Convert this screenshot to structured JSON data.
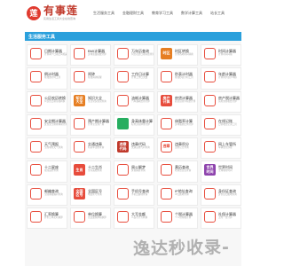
{
  "logo": {
    "name": "有事莲",
    "mark": "莲",
    "slogan": "实用生活工具大全在线查询"
  },
  "nav": [
    "生活服务工具",
    "金融理财工具",
    "教育学习工具",
    "数学计算工具",
    "站长工具"
  ],
  "panel_title": "生活服务工具",
  "tiles": [
    {
      "name": "日期计算器",
      "desc": "计算两个日期之间相差天数",
      "icon": "calendar-icon",
      "glyph": "",
      "color": "#ffffff",
      "fg": "#e74c3c"
    },
    {
      "name": "BMI计算器",
      "desc": "身体质量指数计算",
      "icon": "scale-icon",
      "glyph": "",
      "color": "#ffffff",
      "fg": "#e74c3c"
    },
    {
      "name": "万年历查询",
      "desc": "公历农历日期对照查询",
      "icon": "calendar-icon",
      "glyph": "",
      "color": "#ffffff",
      "fg": "#e74c3c"
    },
    {
      "name": "时区转换",
      "desc": "世界各地时间转换",
      "icon": "timezone-icon",
      "glyph": "时区",
      "color": "#e67e22",
      "fg": "#ffffff"
    },
    {
      "name": "时间计算器",
      "desc": "计算时间间隔",
      "icon": "clock-icon",
      "glyph": "",
      "color": "#ffffff",
      "fg": "#e74c3c"
    },
    {
      "name": "倒计时器",
      "desc": "在线倒计时工具",
      "icon": "stopwatch-icon",
      "glyph": "",
      "color": "#ffffff",
      "fg": "#e74c3c"
    },
    {
      "name": "闹钟",
      "desc": "在线闹钟提醒",
      "icon": "alarm-icon",
      "glyph": "",
      "color": "#ffffff",
      "fg": "#e74c3c"
    },
    {
      "name": "工作日计算",
      "desc": "计算工作日天数",
      "icon": "calendar-icon",
      "glyph": "",
      "color": "#ffffff",
      "fg": "#e74c3c"
    },
    {
      "name": "秒表计时器",
      "desc": "在线秒表计时工具",
      "icon": "timer-icon",
      "glyph": "",
      "color": "#ffffff",
      "fg": "#e74c3c"
    },
    {
      "name": "年龄计算器",
      "desc": "计算周岁虚岁年龄",
      "icon": "person-icon",
      "glyph": "",
      "color": "#ffffff",
      "fg": "#e74c3c"
    },
    {
      "name": "公历农历转换",
      "desc": "公农历日期互相转换",
      "icon": "calendar-icon",
      "glyph": "",
      "color": "#ffffff",
      "fg": "#e74c3c"
    },
    {
      "name": "知识大全",
      "desc": "生活常识知识查询",
      "icon": "knowledge-icon",
      "glyph": "知识\n大全",
      "color": "#e67e22",
      "fg": "#ffffff"
    },
    {
      "name": "油耗计算器",
      "desc": "汽车油耗费用计算",
      "icon": "fuel-icon",
      "glyph": "",
      "color": "#ffffff",
      "fg": "#e74c3c"
    },
    {
      "name": "房贷计算器",
      "desc": "商业贷款公积金计算",
      "icon": "house-loan-icon",
      "glyph": "房产\n计算",
      "color": "#e74c3c",
      "fg": "#ffffff"
    },
    {
      "name": "房产税计算器",
      "desc": "房屋交易税费计算",
      "icon": "house-icon",
      "glyph": "",
      "color": "#ffffff",
      "fg": "#e74c3c"
    },
    {
      "name": "安全期计算器",
      "desc": "女性安全期排卵期计算",
      "icon": "heart-icon",
      "glyph": "",
      "color": "#ffffff",
      "fg": "#e74c3c"
    },
    {
      "name": "预产期计算器",
      "desc": "计算宝宝预产期",
      "icon": "baby-icon",
      "glyph": "",
      "color": "#ffffff",
      "fg": "#e74c3c"
    },
    {
      "name": "身高体重计算",
      "desc": "标准身高体重计算",
      "icon": "height-icon",
      "glyph": "",
      "color": "#27ae60",
      "fg": "#ffffff"
    },
    {
      "name": "体脂率计算",
      "desc": "身体脂肪比例计算",
      "icon": "body-icon",
      "glyph": "",
      "color": "#ffffff",
      "fg": "#e74c3c"
    },
    {
      "name": "在线记账",
      "desc": "日常收支记录工具",
      "icon": "wallet-icon",
      "glyph": "",
      "color": "#ffffff",
      "fg": "#e74c3c"
    },
    {
      "name": "天气预报",
      "desc": "全国城市天气查询",
      "icon": "weather-icon",
      "glyph": "",
      "color": "#ffffff",
      "fg": "#e74c3c"
    },
    {
      "name": "交通违章",
      "desc": "机动车违章查询",
      "icon": "traffic-icon",
      "glyph": "",
      "color": "#ffffff",
      "fg": "#e74c3c"
    },
    {
      "name": "违章代码",
      "desc": "交通违章代码查询",
      "icon": "code-icon",
      "glyph": "违章\n代码",
      "color": "#c0392b",
      "fg": "#ffffff"
    },
    {
      "name": "违章积分",
      "desc": "违章记分查询",
      "icon": "points-icon",
      "glyph": "违章",
      "color": "#ffffff",
      "fg": "#e74c3c"
    },
    {
      "name": "网上车管所",
      "desc": "车辆业务办理",
      "icon": "car-icon",
      "glyph": "",
      "color": "#ffffff",
      "fg": "#e74c3c"
    },
    {
      "name": "十二星座",
      "desc": "星座运势查询",
      "icon": "star-icon",
      "glyph": "",
      "color": "#ffffff",
      "fg": "#e74c3c"
    },
    {
      "name": "十二生肖",
      "desc": "生肖属相查询",
      "icon": "zodiac-icon",
      "glyph": "生肖",
      "color": "#e74c3c",
      "fg": "#ffffff"
    },
    {
      "name": "周公解梦",
      "desc": "梦境解析查询",
      "icon": "dream-icon",
      "glyph": "",
      "color": "#ffffff",
      "fg": "#e74c3c"
    },
    {
      "name": "黄历查询",
      "desc": "老黄历宜忌查询",
      "icon": "almanac-icon",
      "glyph": "",
      "color": "#ffffff",
      "fg": "#e74c3c"
    },
    {
      "name": "世界时间",
      "desc": "全球城市时间",
      "icon": "world-time-icon",
      "glyph": "世界\n时间",
      "color": "#8e44ad",
      "fg": "#ffffff"
    },
    {
      "name": "邮编查询",
      "desc": "全国邮政编码查询",
      "icon": "post-icon",
      "glyph": "",
      "color": "#ffffff",
      "fg": "#e74c3c"
    },
    {
      "name": "全国区号",
      "desc": "电话区号查询",
      "icon": "area-code-icon",
      "glyph": "全国\n区号",
      "color": "#e74c3c",
      "fg": "#ffffff"
    },
    {
      "name": "手机号查询",
      "desc": "手机归属地查询",
      "icon": "phone-icon",
      "glyph": "",
      "color": "#ffffff",
      "fg": "#e74c3c"
    },
    {
      "name": "IP地址查询",
      "desc": "IP归属地查询",
      "icon": "ip-icon",
      "glyph": "",
      "color": "#ffffff",
      "fg": "#e74c3c"
    },
    {
      "name": "身份证查询",
      "desc": "身份证归属地查询",
      "icon": "id-card-icon",
      "glyph": "",
      "color": "#ffffff",
      "fg": "#e74c3c"
    },
    {
      "name": "汇率换算",
      "desc": "外币汇率实时换算",
      "icon": "exchange-icon",
      "glyph": "",
      "color": "#ffffff",
      "fg": "#e74c3c"
    },
    {
      "name": "单位换算",
      "desc": "长度面积体积换算",
      "icon": "unit-icon",
      "glyph": "",
      "color": "#ffffff",
      "fg": "#e74c3c"
    },
    {
      "name": "大写金额",
      "desc": "人民币大写转换",
      "icon": "money-icon",
      "glyph": "",
      "color": "#ffffff",
      "fg": "#e74c3c"
    },
    {
      "name": "个税计算器",
      "desc": "个人所得税计算",
      "icon": "tax-icon",
      "glyph": "",
      "color": "#ffffff",
      "fg": "#e74c3c"
    },
    {
      "name": "社保计算器",
      "desc": "五险一金计算",
      "icon": "insurance-icon",
      "glyph": "",
      "color": "#ffffff",
      "fg": "#e74c3c"
    }
  ],
  "watermark": "逸达秒收录-"
}
